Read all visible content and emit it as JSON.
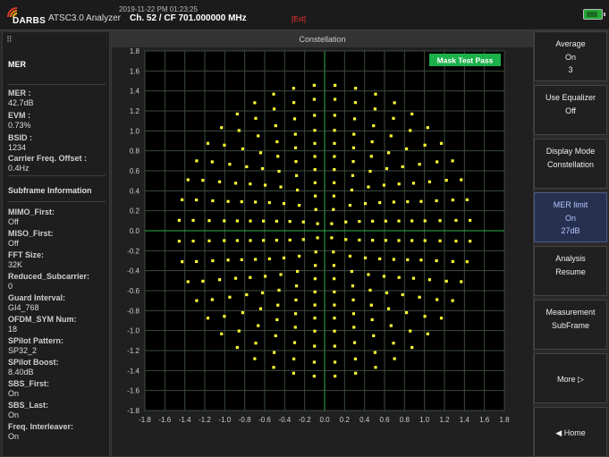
{
  "header": {
    "brand": "DARBS",
    "app_name": "ATSC3.0 Analyzer",
    "datetime": "2019-11-22 PM 01:23:25",
    "channel": "Ch. 52 / CF 701.000000 MHz",
    "ext_tag": "[Ext]"
  },
  "left_panel": {
    "title": "MER",
    "section_title": "Subframe Information",
    "metrics": [
      {
        "label": "MER :",
        "value": "42.7dB"
      },
      {
        "label": "EVM :",
        "value": "0.73%"
      },
      {
        "label": "BSID :",
        "value": "1234"
      },
      {
        "label": "Carrier Freq. Offset :",
        "value": "0.4Hz"
      }
    ],
    "subframe": [
      {
        "label": "MIMO_First:",
        "value": "Off"
      },
      {
        "label": "MISO_First:",
        "value": "Off"
      },
      {
        "label": "FFT Size:",
        "value": "32K"
      },
      {
        "label": "Reduced_Subcarrier:",
        "value": "0"
      },
      {
        "label": "Guard Interval:",
        "value": "GI4_768"
      },
      {
        "label": "OFDM_SYM Num:",
        "value": "18"
      },
      {
        "label": "SPilot Pattern:",
        "value": "SP32_2"
      },
      {
        "label": "SPilot Boost:",
        "value": "8.40dB"
      },
      {
        "label": "SBS_First:",
        "value": "On"
      },
      {
        "label": "SBS_Last:",
        "value": "On"
      },
      {
        "label": "Freq. Interleaver:",
        "value": "On"
      }
    ]
  },
  "center": {
    "title": "Constellation",
    "mask_status": "Mask Test Pass",
    "mask_color": "#1db04a",
    "point_color": "#ffff33",
    "grid_color": "#3b4b3b",
    "axis_color": "#2fae4e"
  },
  "chart_data": {
    "type": "scatter",
    "title": "",
    "xlabel": "",
    "ylabel": "",
    "xlim": [
      -1.8,
      1.8
    ],
    "ylim": [
      -1.8,
      1.8
    ],
    "xticks": [
      "-1.8",
      "-1.6",
      "-1.4",
      "-1.2",
      "-1.0",
      "-0.8",
      "-0.6",
      "-0.4",
      "-0.2",
      "0.0",
      "0.2",
      "0.4",
      "0.6",
      "0.8",
      "1.0",
      "1.2",
      "1.4",
      "1.6",
      "1.8"
    ],
    "yticks": [
      "1.8",
      "1.6",
      "1.4",
      "1.2",
      "1.0",
      "0.8",
      "0.6",
      "0.4",
      "0.2",
      "0.0",
      "-0.2",
      "-0.4",
      "-0.6",
      "-0.8",
      "-1.0",
      "-1.2",
      "-1.4",
      "-1.6",
      "-1.8"
    ],
    "grid": true,
    "series": [
      {
        "rings": [
          {
            "r": 0.1,
            "count": 4
          },
          {
            "r": 0.23,
            "count": 8
          },
          {
            "r": 0.36,
            "count": 12
          },
          {
            "r": 0.49,
            "count": 16
          },
          {
            "r": 0.62,
            "count": 20
          },
          {
            "r": 0.75,
            "count": 24
          },
          {
            "r": 0.88,
            "count": 28
          },
          {
            "r": 1.01,
            "count": 32
          },
          {
            "r": 1.16,
            "count": 36
          },
          {
            "r": 1.32,
            "count": 40
          },
          {
            "r": 1.46,
            "count": 44
          }
        ]
      }
    ]
  },
  "right_panel": {
    "buttons": [
      {
        "l1": "Average",
        "l2": "On",
        "l3": "3",
        "style": "normal"
      },
      {
        "l1": "Use Equalizer",
        "l2": "Off",
        "l3": "",
        "style": "normal"
      },
      {
        "l1": "Display Mode",
        "l2": "Constellation",
        "l3": "",
        "style": "normal"
      },
      {
        "l1": "MER limit",
        "l2": "On",
        "l3": "27dB",
        "style": "blue"
      },
      {
        "l1": "Analysis",
        "l2": "Resume",
        "l3": "",
        "style": "normal"
      },
      {
        "l1": "Measurement",
        "l2": "SubFrame",
        "l3": "",
        "style": "normal"
      },
      {
        "l1": "More ▷",
        "l2": "",
        "l3": "",
        "style": "center"
      },
      {
        "l1": "◀ Home",
        "l2": "",
        "l3": "",
        "style": "center"
      }
    ]
  }
}
